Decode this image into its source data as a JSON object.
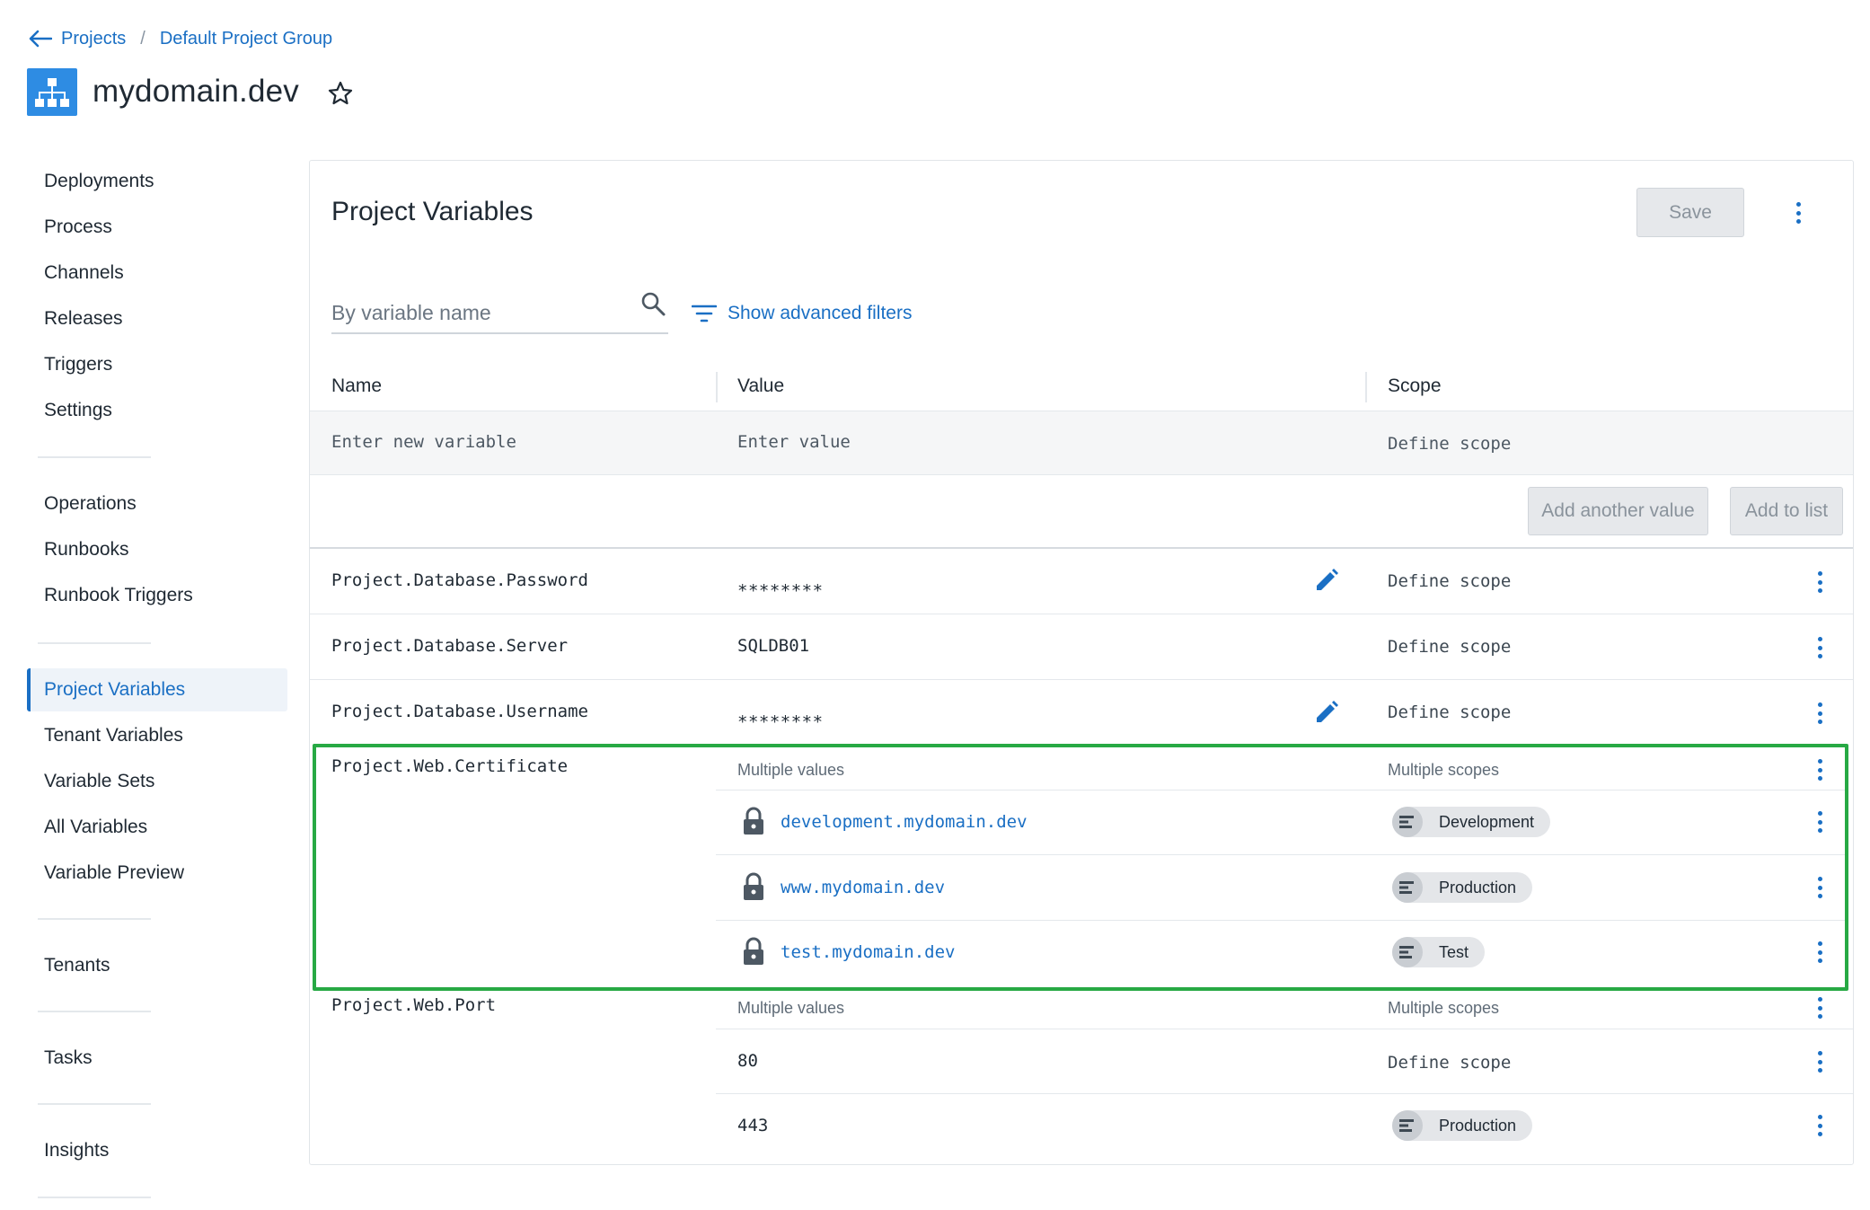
{
  "breadcrumb": {
    "projects": "Projects",
    "separator": "/",
    "group": "Default Project Group"
  },
  "project": {
    "title": "mydomain.dev"
  },
  "sidebar": {
    "items": [
      {
        "label": "Deployments"
      },
      {
        "label": "Process"
      },
      {
        "label": "Channels"
      },
      {
        "label": "Releases"
      },
      {
        "label": "Triggers"
      },
      {
        "label": "Settings"
      },
      {
        "label": "Operations"
      },
      {
        "label": "Runbooks"
      },
      {
        "label": "Runbook Triggers"
      },
      {
        "label": "Project Variables"
      },
      {
        "label": "Tenant Variables"
      },
      {
        "label": "Variable Sets"
      },
      {
        "label": "All Variables"
      },
      {
        "label": "Variable Preview"
      },
      {
        "label": "Tenants"
      },
      {
        "label": "Tasks"
      },
      {
        "label": "Insights"
      }
    ],
    "active": "Project Variables"
  },
  "main": {
    "title": "Project Variables",
    "save_label": "Save",
    "search_placeholder": "By variable name",
    "filter_label": "Show advanced filters",
    "columns": {
      "name": "Name",
      "value": "Value",
      "scope": "Scope"
    },
    "new_row": {
      "name_placeholder": "Enter new variable",
      "value_placeholder": "Enter value",
      "scope_placeholder": "Define scope",
      "add_value_label": "Add another value",
      "add_list_label": "Add to list"
    },
    "variables": [
      {
        "name": "Project.Database.Password",
        "value": "********",
        "scope": "Define scope"
      },
      {
        "name": "Project.Database.Server",
        "value": "SQLDB01",
        "scope": "Define scope"
      },
      {
        "name": "Project.Database.Username",
        "value": "********",
        "scope": "Define scope"
      },
      {
        "name": "Project.Web.Certificate",
        "value_summary": "Multiple values",
        "scope_summary": "Multiple scopes",
        "values": [
          {
            "value": "development.mydomain.dev",
            "scope": "Development"
          },
          {
            "value": "www.mydomain.dev",
            "scope": "Production"
          },
          {
            "value": "test.mydomain.dev",
            "scope": "Test"
          }
        ]
      },
      {
        "name": "Project.Web.Port",
        "value_summary": "Multiple values",
        "scope_summary": "Multiple scopes",
        "values": [
          {
            "value": "80",
            "scope": "Define scope"
          },
          {
            "value": "443",
            "scope": "Production"
          }
        ]
      }
    ]
  },
  "colors": {
    "accent": "#1a6fc4",
    "highlight": "#27a944",
    "logo": "#2e8ce3"
  },
  "icons": [
    "back-arrow-icon",
    "project-logo-icon",
    "star-icon",
    "search-icon",
    "filter-icon",
    "edit-icon",
    "lock-icon",
    "environment-icon",
    "kebab-menu-icon"
  ]
}
